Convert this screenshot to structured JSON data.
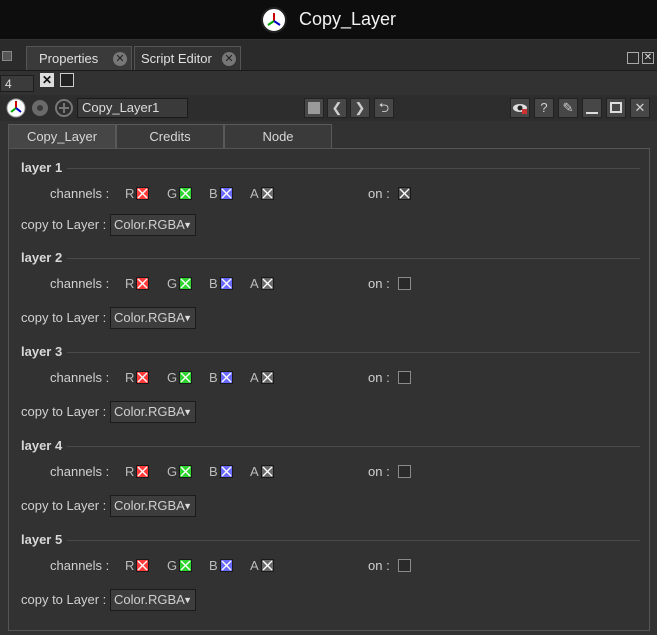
{
  "window": {
    "title": "Copy_Layer"
  },
  "tabs": [
    {
      "label": "Properties"
    },
    {
      "label": "Script Editor"
    }
  ],
  "stack": {
    "count": "4"
  },
  "node": {
    "name": "Copy_Layer1"
  },
  "panel_tabs": [
    {
      "label": "Copy_Layer",
      "active": true
    },
    {
      "label": "Credits",
      "active": false
    },
    {
      "label": "Node",
      "active": false
    }
  ],
  "labels": {
    "channels": "channels :",
    "copy_to": "copy to Layer :",
    "on": "on :",
    "r": "R",
    "g": "G",
    "b": "B",
    "a": "A"
  },
  "channel_colors": {
    "r": "#ff3b3b",
    "g": "#2ed42e",
    "b": "#6a6aff",
    "a": "#6a6a6a"
  },
  "layers": [
    {
      "title": "layer 1",
      "target": "Color.RGBA",
      "on": true
    },
    {
      "title": "layer 2",
      "target": "Color.RGBA",
      "on": false
    },
    {
      "title": "layer 3",
      "target": "Color.RGBA",
      "on": false
    },
    {
      "title": "layer 4",
      "target": "Color.RGBA",
      "on": false
    },
    {
      "title": "layer 5",
      "target": "Color.RGBA",
      "on": false
    }
  ],
  "icons": [
    "app-logo-icon",
    "pane-menu-icon",
    "close-icon",
    "maximize-icon",
    "node-logo-icon",
    "gear-icon",
    "add-circle-icon",
    "color-swatch-icon",
    "arrow-left-icon",
    "arrow-right-icon",
    "sync-icon",
    "eye-icon",
    "help-icon",
    "pin-icon",
    "minimize-icon",
    "float-icon",
    "close-panel-icon"
  ]
}
